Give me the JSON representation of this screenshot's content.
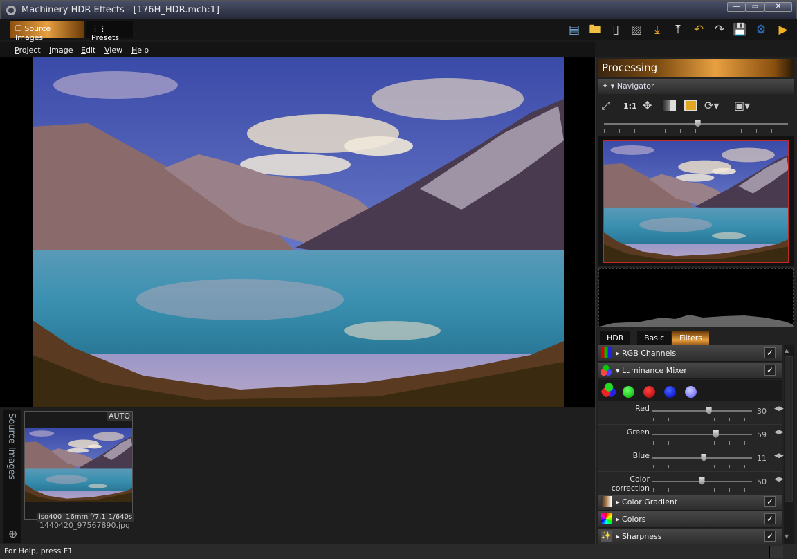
{
  "window": {
    "title": "Machinery HDR Effects - [176H_HDR.mch:1]",
    "controls": [
      "minimize",
      "maximize",
      "close"
    ]
  },
  "toolbar": {
    "tabs": [
      {
        "label": "Source Images",
        "active": true,
        "icon": "source-images-icon"
      },
      {
        "label": "Presets",
        "active": false,
        "icon": "presets-icon"
      }
    ],
    "icons": [
      "image-icon",
      "folder-open-icon",
      "new-document-icon",
      "pattern-icon",
      "import-icon",
      "export-icon",
      "undo-icon",
      "redo-icon",
      "save-icon",
      "settings-gear-icon",
      "more-arrow-icon"
    ]
  },
  "menu": [
    "Project",
    "Image",
    "Edit",
    "View",
    "Help"
  ],
  "panel": {
    "title": "Processing",
    "navigator": {
      "label": "Navigator",
      "zoom_label": "1:1",
      "zoom_level": 0.51
    },
    "tabs": [
      {
        "label": "HDR"
      },
      {
        "label": "Basic"
      },
      {
        "label": "Filters",
        "active": true
      }
    ],
    "filters": [
      {
        "label": "RGB Channels",
        "checked": true,
        "expanded": false
      },
      {
        "label": "Luminance Mixer",
        "checked": true,
        "expanded": true
      }
    ],
    "mixer_presets": [
      "all-channels",
      "green",
      "red",
      "blue",
      "light-blue"
    ],
    "sliders": [
      {
        "label": "Red",
        "value": "30",
        "level": 0.57
      },
      {
        "label": "Green",
        "value": "59",
        "level": 0.64
      },
      {
        "label": "Blue",
        "value": "11",
        "level": 0.52
      },
      {
        "label": "Color correction",
        "value": "50",
        "level": 0.5
      }
    ],
    "filters_below": [
      {
        "label": "Color Gradient",
        "checked": true
      },
      {
        "label": "Colors",
        "checked": true
      },
      {
        "label": "Sharpness",
        "checked": true
      }
    ]
  },
  "filmstrip": {
    "side_label": "Source Images",
    "badge": "AUTO",
    "meta": [
      "iso400",
      "16mm",
      "f/7.1",
      "1/640s"
    ],
    "filename": "1440420_97567890.jpg"
  },
  "status": "For Help, press F1",
  "colors": {
    "accent": "#e8a040",
    "nav_frame": "#c0282a"
  }
}
